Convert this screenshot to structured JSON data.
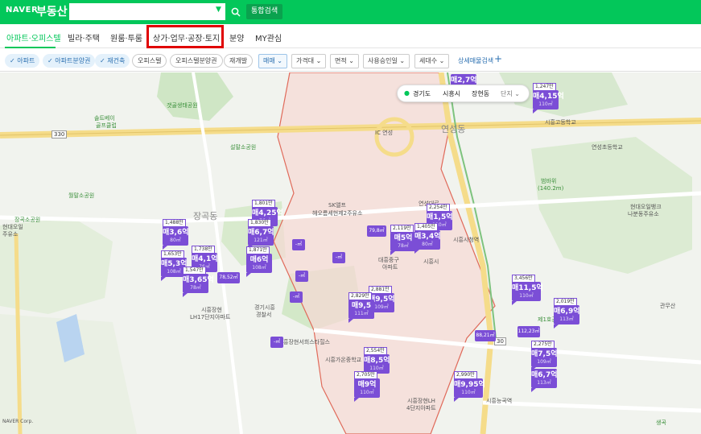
{
  "header": {
    "logo": "NAVER",
    "service": "부동산",
    "search_value": "",
    "search_button_label": "통합검색"
  },
  "nav": {
    "tabs": [
      "아파트·오피스텔",
      "빌라·주택",
      "원룸·투룸",
      "상가·업무·공장·토지",
      "분양",
      "MY관심"
    ],
    "active": "아파트·오피스텔"
  },
  "filters": {
    "type_chips": [
      {
        "label": "아파트",
        "on": true
      },
      {
        "label": "아파트분양권",
        "on": true
      },
      {
        "label": "재건축",
        "on": true
      },
      {
        "label": "오피스텔",
        "on": false
      },
      {
        "label": "오피스텔분양권",
        "on": false
      },
      {
        "label": "재개발",
        "on": false
      }
    ],
    "dropdowns": [
      {
        "label": "매매",
        "on": true
      },
      {
        "label": "가격대",
        "on": false
      },
      {
        "label": "면적",
        "on": false
      },
      {
        "label": "사용승인일",
        "on": false
      },
      {
        "label": "세대수",
        "on": false
      }
    ],
    "detail_search": "상세매물검색",
    "plus": "+"
  },
  "breadcrumb": {
    "province": "경기도",
    "city": "시흥시",
    "dong": "장현동",
    "complex": "단지"
  },
  "map": {
    "labels": [
      {
        "text": "연성동",
        "style": "big"
      },
      {
        "text": "장곡동",
        "style": "big"
      },
      {
        "text": "시흥시청역",
        "style": "normal"
      },
      {
        "text": "시흥능곡역",
        "style": "normal"
      },
      {
        "text": "시흥고등학교",
        "style": "normal"
      },
      {
        "text": "연성초등학교",
        "style": "normal"
      },
      {
        "text": "범바위",
        "style": "green"
      },
      {
        "text": "(140.2m)",
        "style": "green"
      },
      {
        "text": "현대오일뱅크",
        "style": "normal"
      },
      {
        "text": "나분동주유소",
        "style": "normal"
      },
      {
        "text": "관무산",
        "style": "normal"
      },
      {
        "text": "제1호공원",
        "style": "green"
      },
      {
        "text": "생곡",
        "style": "green"
      },
      {
        "text": "시흥장현",
        "style": "normal"
      },
      {
        "text": "LH17단지아파트",
        "style": "normal"
      },
      {
        "text": "경기시흥",
        "style": "normal"
      },
      {
        "text": "경찰서",
        "style": "normal"
      },
      {
        "text": "시흥장현LH",
        "style": "normal"
      },
      {
        "text": "4단지아파트",
        "style": "normal"
      },
      {
        "text": "대흥중구",
        "style": "normal"
      },
      {
        "text": "아파트",
        "style": "normal"
      },
      {
        "text": "SK앨프",
        "style": "normal"
      },
      {
        "text": "헤오름세현제2주유소",
        "style": "normal"
      },
      {
        "text": "솔트베이",
        "style": "green"
      },
      {
        "text": "골프클럽",
        "style": "green"
      },
      {
        "text": "갯골생태공원",
        "style": "green"
      },
      {
        "text": "설말소공원",
        "style": "green"
      },
      {
        "text": "월말소공원",
        "style": "green"
      },
      {
        "text": "330",
        "style": "road"
      },
      {
        "text": "30",
        "style": "road"
      },
      {
        "text": "IC 연성",
        "style": "normal"
      },
      {
        "text": "연성대로",
        "style": "normal"
      },
      {
        "text": "현대오일",
        "style": "normal"
      },
      {
        "text": "주유소",
        "style": "normal"
      },
      {
        "text": "장곡소공원",
        "style": "green"
      },
      {
        "text": "시흥가온중학교",
        "style": "normal"
      },
      {
        "text": "흥장현서희스타힐스",
        "style": "normal"
      },
      {
        "text": "시흥시",
        "style": "normal"
      }
    ],
    "markers": [
      {
        "top": "1,247만",
        "price": "매4,15억",
        "area": "110㎡"
      },
      {
        "top": "1,801만",
        "price": "매4,25억",
        "area": "76㎡"
      },
      {
        "top": "1,488만",
        "price": "매3,6억",
        "area": "80㎡"
      },
      {
        "top": "1,830만",
        "price": "매6,7억",
        "area": "121㎡"
      },
      {
        "top": "1,871만",
        "price": "매6억",
        "area": "108㎡"
      },
      {
        "top": "1,738만",
        "price": "매4,1억",
        "area": "76㎡"
      },
      {
        "top": "1,653만",
        "price": "매5,3억",
        "area": "108㎡"
      },
      {
        "top": "1,547만",
        "price": "매3,65억",
        "area": "78㎡"
      },
      {
        "top": "2,119만",
        "price": "매5억",
        "area": "78㎡"
      },
      {
        "top": "2,254만",
        "price": "매1,5억",
        "area": "110㎡"
      },
      {
        "top": "1,405만",
        "price": "매3,4억",
        "area": "80㎡"
      },
      {
        "top": "2,881만",
        "price": "매9,5억",
        "area": "109㎡"
      },
      {
        "top": "2,829만",
        "price": "매9,5",
        "area": "111㎡"
      },
      {
        "top": "2,554만",
        "price": "매8,5억",
        "area": "110㎡"
      },
      {
        "top": "2,705만",
        "price": "매9억",
        "area": "110㎡"
      },
      {
        "top": "2,990만",
        "price": "매9,95억",
        "area": "110㎡"
      },
      {
        "top": "3,456만",
        "price": "매11,5억",
        "area": "110㎡"
      },
      {
        "top": "2,019만",
        "price": "매6,9억",
        "area": "113㎡"
      },
      {
        "top": "2,275만",
        "price": "매7,5억",
        "area": "109㎡"
      },
      {
        "top": "",
        "price": "매6,7억",
        "area": "113㎡"
      },
      {
        "top": "",
        "price": "매2,7억",
        "area": ""
      }
    ],
    "small_tags": [
      "79,8㎡",
      "88,21㎡",
      "112,23㎡",
      "78,52㎡",
      "-㎡",
      "-㎡",
      "-㎡",
      "-㎡",
      "-㎡"
    ],
    "copyright": "NAVER Corp."
  },
  "colors": {
    "brand": "#03c75a",
    "marker": "#7b4ed6",
    "highlight_box": "#e00000",
    "district_fill": "#f6d9d4",
    "district_border": "#e06a5a"
  }
}
